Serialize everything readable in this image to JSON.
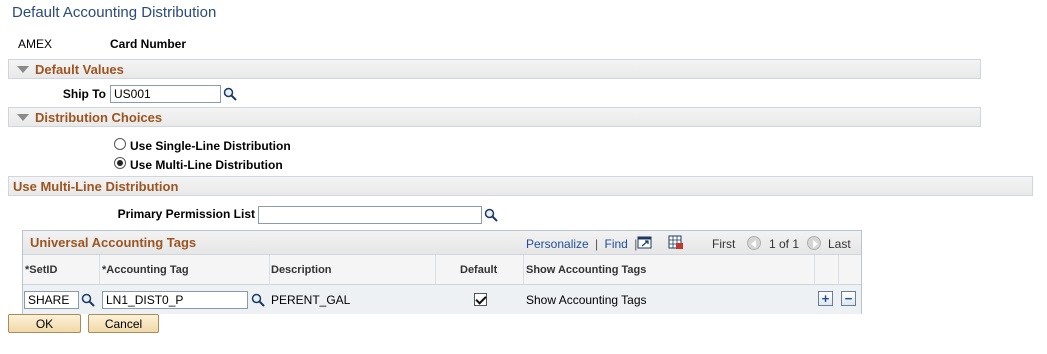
{
  "page": {
    "title": "Default Accounting Distribution"
  },
  "card": {
    "type": "AMEX",
    "number_label": "Card Number"
  },
  "default_values": {
    "section_label": "Default Values",
    "ship_to_label": "Ship To",
    "ship_to_value": "US001"
  },
  "distribution_choices": {
    "section_label": "Distribution Choices",
    "options": [
      {
        "label": "Use Single-Line Distribution",
        "selected": false
      },
      {
        "label": "Use Multi-Line Distribution",
        "selected": true
      }
    ]
  },
  "multi_line": {
    "section_label": "Use Multi-Line Distribution",
    "primary_permission_label": "Primary Permission List",
    "primary_permission_value": ""
  },
  "grid": {
    "title": "Universal Accounting Tags",
    "personalize_label": "Personalize",
    "separator": "|",
    "find_label": "Find",
    "first_label": "First",
    "pagination": "1 of 1",
    "last_label": "Last",
    "columns": {
      "setid": "*SetID",
      "accounting_tag": "*Accounting Tag",
      "description": "Description",
      "default": "Default",
      "show_tags": "Show Accounting Tags"
    },
    "rows": [
      {
        "setid": "SHARE",
        "accounting_tag": "LN1_DIST0_P",
        "description": "PERENT_GAL",
        "default_checked": true,
        "show_tags_link": "Show Accounting Tags"
      }
    ],
    "add_row_symbol": "+",
    "delete_row_symbol": "−"
  },
  "buttons": {
    "ok": "OK",
    "cancel": "Cancel"
  },
  "colors": {
    "title": "#2a4b7c",
    "section_label": "#9c5520",
    "link": "#1f4e99",
    "button_bg": "#f0d9a8"
  },
  "icons": {
    "lookup": "magnifier-icon",
    "collapse": "collapse-triangle-icon",
    "view_all": "zoom-window-icon",
    "download": "download-grid-icon"
  }
}
